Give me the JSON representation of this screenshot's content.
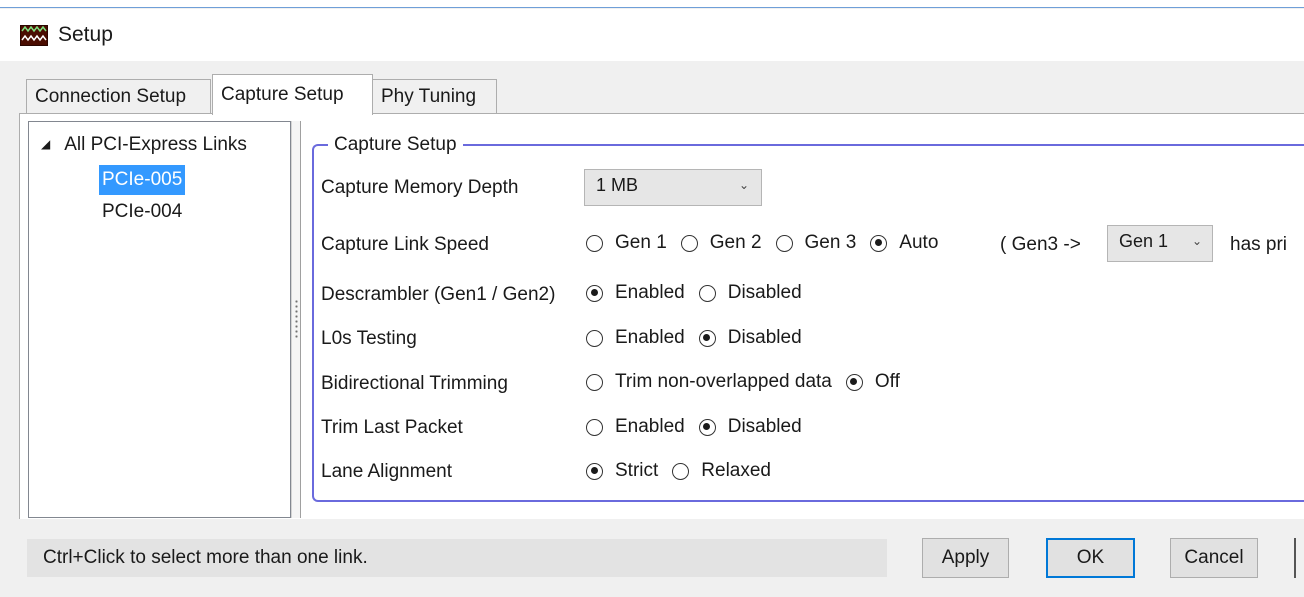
{
  "window": {
    "title": "Setup",
    "icon": "app-waveform-icon"
  },
  "tabs": [
    {
      "label": "Connection Setup",
      "active": false
    },
    {
      "label": "Capture Setup",
      "active": true
    },
    {
      "label": "Phy Tuning",
      "active": false
    }
  ],
  "tree": {
    "root_label": "All PCI-Express Links",
    "items": [
      {
        "label": "PCIe-005",
        "selected": true
      },
      {
        "label": "PCIe-004",
        "selected": false
      }
    ]
  },
  "capture": {
    "group_title": "Capture Setup",
    "memory_depth": {
      "label": "Capture Memory Depth",
      "value": "1 MB"
    },
    "link_speed": {
      "label": "Capture Link Speed",
      "options": [
        "Gen 1",
        "Gen 2",
        "Gen 3",
        "Auto"
      ],
      "selected": "Auto",
      "note_prefix": "( Gen3 ->",
      "priority_value": "Gen 1",
      "note_suffix": "has pri"
    },
    "descrambler": {
      "label": "Descrambler (Gen1 / Gen2)",
      "options": [
        "Enabled",
        "Disabled"
      ],
      "selected": "Enabled"
    },
    "l0s_testing": {
      "label": "L0s Testing",
      "options": [
        "Enabled",
        "Disabled"
      ],
      "selected": "Disabled"
    },
    "bidirectional_trimming": {
      "label": "Bidirectional Trimming",
      "options": [
        "Trim non-overlapped data",
        "Off"
      ],
      "selected": "Off"
    },
    "trim_last_packet": {
      "label": "Trim Last Packet",
      "options": [
        "Enabled",
        "Disabled"
      ],
      "selected": "Disabled"
    },
    "lane_alignment": {
      "label": "Lane Alignment",
      "options": [
        "Strict",
        "Relaxed"
      ],
      "selected": "Strict"
    }
  },
  "footer": {
    "hint": "Ctrl+Click to select more than one link.",
    "apply_label": "Apply",
    "ok_label": "OK",
    "cancel_label": "Cancel"
  },
  "colors": {
    "selection": "#3399ff",
    "group_border": "#6a6add",
    "default_button_border": "#0078d7"
  }
}
